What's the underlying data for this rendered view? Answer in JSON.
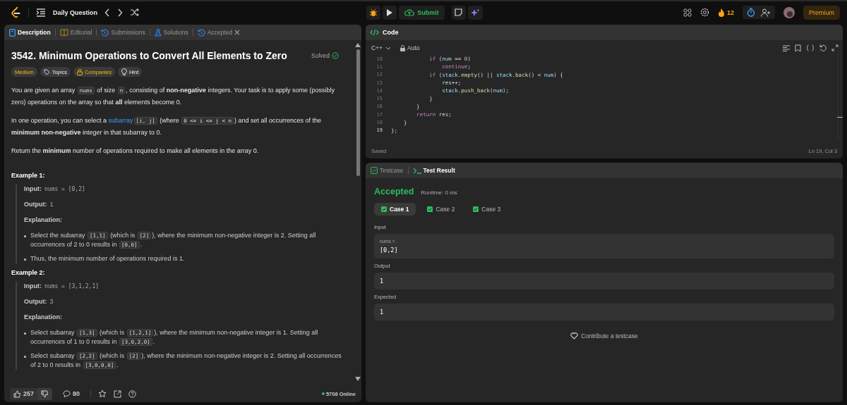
{
  "topbar": {
    "title": "Daily Question",
    "submit": "Submit",
    "streak": "12",
    "premium": "Premium"
  },
  "left_tabs": [
    {
      "label": "Description",
      "selected": true,
      "kind": "doc",
      "closable": false
    },
    {
      "label": "Editorial",
      "selected": false,
      "kind": "book",
      "closable": false
    },
    {
      "label": "Submissions",
      "selected": false,
      "kind": "history",
      "closable": false
    },
    {
      "label": "Solutions",
      "selected": false,
      "kind": "flask",
      "closable": false
    },
    {
      "label": "Accepted",
      "selected": false,
      "kind": "history",
      "closable": true
    }
  ],
  "problem": {
    "title": "3542. Minimum Operations to Convert All Elements to Zero",
    "status": "Solved",
    "tags": [
      {
        "label": "Medium",
        "kind": "difficulty"
      },
      {
        "label": "Topics",
        "kind": "topics"
      },
      {
        "label": "Companies",
        "kind": "companies"
      },
      {
        "label": "Hint",
        "kind": "hint"
      }
    ],
    "paragraphs": [
      [
        {
          "kind": "text",
          "text": "You are given an array "
        },
        {
          "kind": "code",
          "text": "nums"
        },
        {
          "kind": "text",
          "text": " of size "
        },
        {
          "kind": "code",
          "text": "n"
        },
        {
          "kind": "text",
          "text": ", consisting of **non-negative** integers. Your task is to apply some (possibly zero) operations on the array so that **all** elements become 0."
        }
      ],
      [
        {
          "kind": "text",
          "text": "In one operation, you can select a "
        },
        {
          "kind": "link",
          "text": "subarray"
        },
        {
          "kind": "code",
          "text": "[i, j]"
        },
        {
          "kind": "text",
          "text": " (where "
        },
        {
          "kind": "code",
          "text": "0 <= i <= j < n"
        },
        {
          "kind": "text",
          "text": ") and set all occurrences of the **minimum non-negative** integer in that subarray to 0."
        }
      ],
      [
        {
          "kind": "text",
          "text": "Return the **minimum** number of operations required to make all elements in the array 0."
        }
      ]
    ],
    "examples": [
      {
        "heading": "Example 1:",
        "input_label": "Input:",
        "input": "nums = [0,2]",
        "output_label": "Output:",
        "output": "1",
        "explanation_label": "Explanation:",
        "bullets": [
          [
            {
              "kind": "text",
              "text": "Select the subarray "
            },
            {
              "kind": "code",
              "text": "[1,1]"
            },
            {
              "kind": "text",
              "text": " (which is "
            },
            {
              "kind": "code",
              "text": "[2]"
            },
            {
              "kind": "text",
              "text": "), where the minimum non-negative integer is 2. Setting all occurrences of 2 to 0 results in "
            },
            {
              "kind": "code",
              "text": "[0,0]"
            },
            {
              "kind": "text",
              "text": "."
            }
          ],
          [
            {
              "kind": "text",
              "text": "Thus, the minimum number of operations required is 1."
            }
          ]
        ]
      },
      {
        "heading": "Example 2:",
        "input_label": "Input:",
        "input": "nums = [3,1,2,1]",
        "output_label": "Output:",
        "output": "3",
        "explanation_label": "Explanation:",
        "bullets": [
          [
            {
              "kind": "text",
              "text": "Select subarray "
            },
            {
              "kind": "code",
              "text": "[1,3]"
            },
            {
              "kind": "text",
              "text": " (which is "
            },
            {
              "kind": "code",
              "text": "[1,2,1]"
            },
            {
              "kind": "text",
              "text": "), where the minimum non-negative integer is 1. Setting all occurrences of 1 to 0 results in "
            },
            {
              "kind": "code",
              "text": "[3,0,2,0]"
            },
            {
              "kind": "text",
              "text": "."
            }
          ],
          [
            {
              "kind": "text",
              "text": "Select subarray "
            },
            {
              "kind": "code",
              "text": "[2,2]"
            },
            {
              "kind": "text",
              "text": " (which is "
            },
            {
              "kind": "code",
              "text": "[2]"
            },
            {
              "kind": "text",
              "text": "), where the minimum non-negative integer is 2. Setting all occurrences of 2 to 0 results in "
            },
            {
              "kind": "code",
              "text": "[3,0,0,0]"
            },
            {
              "kind": "text",
              "text": "."
            }
          ]
        ]
      }
    ]
  },
  "footer": {
    "likes": "257",
    "comments": "80",
    "online": "5708 Online"
  },
  "editor": {
    "title": "Code",
    "language": "C++",
    "mode": "Auto",
    "status": "Saved",
    "cursor": "Ln 19, Col 3",
    "lines": [
      {
        "number": "10",
        "current": false,
        "tokens": [
          {
            "kind": "kw",
            "text": "            if"
          },
          {
            "kind": "plain",
            "text": " ("
          },
          {
            "kind": "var",
            "text": "num"
          },
          {
            "kind": "plain",
            "text": " == "
          },
          {
            "kind": "num",
            "text": "0"
          },
          {
            "kind": "plain",
            "text": ")"
          }
        ]
      },
      {
        "number": "11",
        "current": false,
        "tokens": [
          {
            "kind": "kw",
            "text": "                continue"
          },
          {
            "kind": "plain",
            "text": ";"
          }
        ]
      },
      {
        "number": "12",
        "current": false,
        "tokens": [
          {
            "kind": "kw",
            "text": "            if"
          },
          {
            "kind": "plain",
            "text": " ("
          },
          {
            "kind": "var",
            "text": "stack"
          },
          {
            "kind": "plain",
            "text": "."
          },
          {
            "kind": "fn",
            "text": "empty"
          },
          {
            "kind": "plain",
            "text": "() || "
          },
          {
            "kind": "var",
            "text": "stack"
          },
          {
            "kind": "plain",
            "text": "."
          },
          {
            "kind": "fn",
            "text": "back"
          },
          {
            "kind": "plain",
            "text": "() < "
          },
          {
            "kind": "var",
            "text": "num"
          },
          {
            "kind": "plain",
            "text": ") {"
          }
        ]
      },
      {
        "number": "13",
        "current": false,
        "tokens": [
          {
            "kind": "plain",
            "text": "                res++;"
          }
        ]
      },
      {
        "number": "14",
        "current": false,
        "tokens": [
          {
            "kind": "var",
            "text": "                stack"
          },
          {
            "kind": "plain",
            "text": "."
          },
          {
            "kind": "fn",
            "text": "push_back"
          },
          {
            "kind": "plain",
            "text": "("
          },
          {
            "kind": "var",
            "text": "num"
          },
          {
            "kind": "plain",
            "text": ");"
          }
        ]
      },
      {
        "number": "15",
        "current": false,
        "tokens": [
          {
            "kind": "plain",
            "text": "            }"
          }
        ]
      },
      {
        "number": "16",
        "current": false,
        "tokens": [
          {
            "kind": "plain",
            "text": "        }"
          }
        ]
      },
      {
        "number": "17",
        "current": false,
        "tokens": [
          {
            "kind": "kw",
            "text": "        return"
          },
          {
            "kind": "plain",
            "text": " res;"
          }
        ]
      },
      {
        "number": "18",
        "current": false,
        "tokens": [
          {
            "kind": "plain",
            "text": "    }"
          }
        ]
      },
      {
        "number": "19",
        "current": true,
        "tokens": [
          {
            "kind": "plain",
            "text": "};"
          }
        ]
      }
    ]
  },
  "results": {
    "tabs": [
      {
        "label": "Testcase",
        "selected": false,
        "kind": "check"
      },
      {
        "label": "Test Result",
        "selected": true,
        "kind": "terminal"
      }
    ],
    "verdict": "Accepted",
    "runtime": "Runtime: 0 ms",
    "cases": [
      {
        "label": "Case 1",
        "selected": true
      },
      {
        "label": "Case 2",
        "selected": false
      },
      {
        "label": "Case 3",
        "selected": false
      }
    ],
    "sections": [
      {
        "label": "Input",
        "var": "nums =",
        "value": "[0,2]"
      },
      {
        "label": "Output",
        "value": "1"
      },
      {
        "label": "Expected",
        "value": "1"
      }
    ],
    "contribute": "Contribute a testcase"
  }
}
